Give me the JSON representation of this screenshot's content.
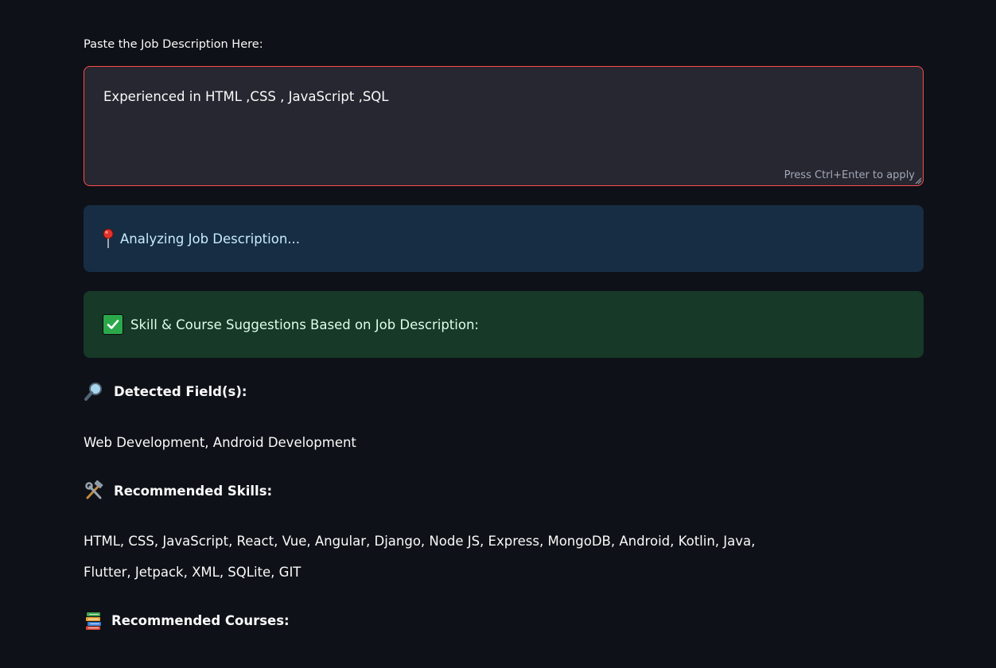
{
  "form": {
    "label": "Paste the Job Description Here:",
    "textarea_value": "Experienced in HTML ,CSS , JavaScript ,SQL",
    "hint": "Press Ctrl+Enter to apply"
  },
  "info_alert": {
    "icon": "pushpin-icon",
    "text": "Analyzing Job Description..."
  },
  "success_alert": {
    "icon": "check-box-icon",
    "text": "Skill & Course Suggestions Based on Job Description:"
  },
  "sections": {
    "fields": {
      "icon": "magnifier-icon",
      "heading": "Detected Field(s):",
      "body": "Web Development, Android Development"
    },
    "skills": {
      "icon": "hammer-wrench-icon",
      "heading": "Recommended Skills:",
      "body_line1": "HTML, CSS, JavaScript, React, Vue, Angular, Django, Node JS, Express, MongoDB, Android, Kotlin, Java,",
      "body_line2": "Flutter, Jetpack, XML, SQLite, GIT"
    },
    "courses": {
      "icon": "books-icon",
      "heading": "Recommended Courses:"
    }
  },
  "colors": {
    "background": "#0e1117",
    "input_bg": "#262730",
    "input_border_focus": "#ff4b4b",
    "info_bg": "#172d43",
    "info_text": "#c7ebff",
    "success_bg": "#173928",
    "success_text": "#dffde9"
  }
}
